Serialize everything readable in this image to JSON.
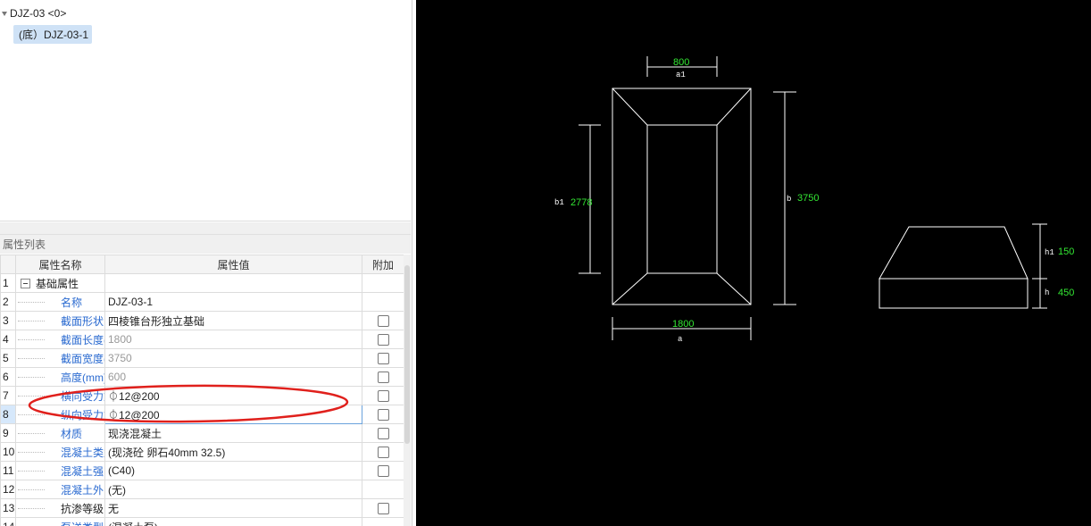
{
  "tree": {
    "root_label": "DJZ-03 <0>",
    "child_label": "(底）DJZ-03-1"
  },
  "properties": {
    "title": "属性列表",
    "columns": [
      "",
      "属性名称",
      "属性值",
      "附加"
    ],
    "rows": [
      {
        "num": "1",
        "name": "基础属性",
        "value": "",
        "group": true,
        "checkbox": false
      },
      {
        "num": "2",
        "name": "名称",
        "value": "DJZ-03-1",
        "checkbox": false
      },
      {
        "num": "3",
        "name": "截面形状",
        "value": "四棱锥台形独立基础",
        "checkbox": true
      },
      {
        "num": "4",
        "name": "截面长度(...",
        "value": "1800",
        "gray": true,
        "checkbox": true
      },
      {
        "num": "5",
        "name": "截面宽度(...",
        "value": "3750",
        "gray": true,
        "checkbox": true
      },
      {
        "num": "6",
        "name": "高度(mm)",
        "value": "600",
        "gray": true,
        "checkbox": true
      },
      {
        "num": "7",
        "name": "横向受力筋",
        "value": "⏀12@200",
        "checkbox": true
      },
      {
        "num": "8",
        "name": "纵向受力筋",
        "value": "⏀12@200",
        "checkbox": true,
        "selected": true
      },
      {
        "num": "9",
        "name": "材质",
        "value": "现浇混凝土",
        "checkbox": true
      },
      {
        "num": "10",
        "name": "混凝土类型",
        "value": "(现浇砼 卵石40mm 32.5)",
        "checkbox": true
      },
      {
        "num": "11",
        "name": "混凝土强...",
        "value": "(C40)",
        "checkbox": true
      },
      {
        "num": "12",
        "name": "混凝土外...",
        "value": "(无)",
        "checkbox": false
      },
      {
        "num": "13",
        "name": "抗渗等级",
        "value": "无",
        "black": true,
        "checkbox": true
      },
      {
        "num": "14",
        "name": "泵送类型",
        "value": "(混凝土泵)",
        "checkbox": false
      }
    ]
  },
  "cad": {
    "top_width_value": "800",
    "top_width_label": "a1",
    "bottom_width_value": "1800",
    "bottom_width_label": "a",
    "inner_height_label": "b1",
    "inner_height_value": "2778",
    "outer_height_label": "b",
    "outer_height_value": "3750",
    "h1_label": "h1",
    "h1_value": "150",
    "h_label": "h",
    "h_value": "450"
  },
  "colors": {
    "cad_background": "#000000",
    "dimension_text": "#33e633",
    "annotation_ellipse": "#e0201c",
    "property_name_blue": "#2a6ad0"
  }
}
